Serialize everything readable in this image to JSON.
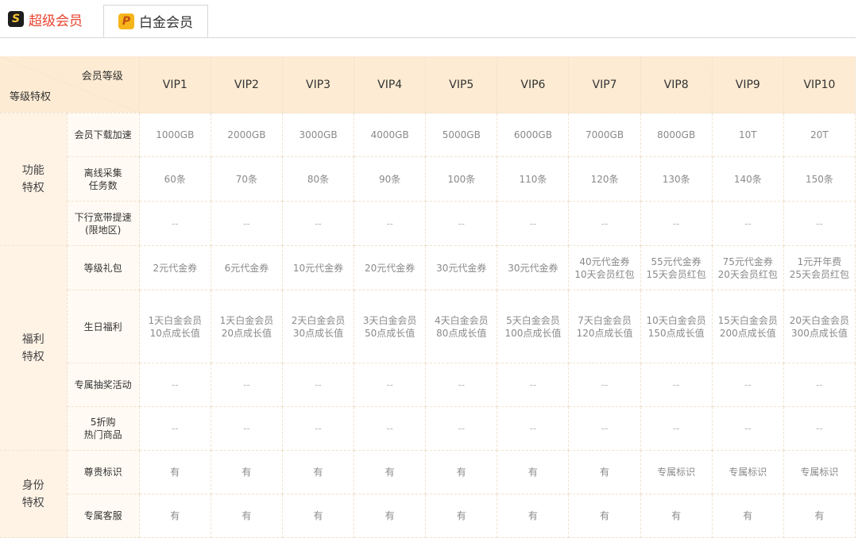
{
  "tabs": [
    {
      "icon": "S",
      "label": "超级会员"
    },
    {
      "icon": "P",
      "label": "白金会员"
    }
  ],
  "table": {
    "corner_top": "会员等级",
    "corner_bottom": "等级特权",
    "levels": [
      "VIP1",
      "VIP2",
      "VIP3",
      "VIP4",
      "VIP5",
      "VIP6",
      "VIP7",
      "VIP8",
      "VIP9",
      "VIP10"
    ],
    "groups": [
      {
        "name_line1": "功能",
        "name_line2": "特权",
        "rows": [
          {
            "feature": "会员下载加速",
            "values": [
              "1000GB",
              "2000GB",
              "3000GB",
              "4000GB",
              "5000GB",
              "6000GB",
              "7000GB",
              "8000GB",
              "10T",
              "20T"
            ]
          },
          {
            "feature": "离线采集\n任务数",
            "values": [
              "60条",
              "70条",
              "80条",
              "90条",
              "100条",
              "110条",
              "120条",
              "130条",
              "140条",
              "150条"
            ]
          },
          {
            "feature": "下行宽带提速\n(限地区)",
            "values": [
              "--",
              "--",
              "--",
              "--",
              "--",
              "--",
              "--",
              "--",
              "--",
              "--"
            ]
          }
        ]
      },
      {
        "name_line1": "福利",
        "name_line2": "特权",
        "rows": [
          {
            "feature": "等级礼包",
            "values": [
              "2元代金券",
              "6元代金券",
              "10元代金券",
              "20元代金券",
              "30元代金券",
              "30元代金券",
              "40元代金券\n10天会员红包",
              "55元代金券\n15天会员红包",
              "75元代金券\n20天会员红包",
              "1元开年费\n25天会员红包"
            ]
          },
          {
            "feature": "生日福利",
            "values": [
              "1天白金会员\n10点成长值",
              "1天白金会员\n20点成长值",
              "2天白金会员\n30点成长值",
              "3天白金会员\n50点成长值",
              "4天白金会员\n80点成长值",
              "5天白金会员\n100点成长值",
              "7天白金会员\n120点成长值",
              "10天白金会员\n150点成长值",
              "15天白金会员\n200点成长值",
              "20天白金会员\n300点成长值"
            ]
          },
          {
            "feature": "专属抽奖活动",
            "values": [
              "--",
              "--",
              "--",
              "--",
              "--",
              "--",
              "--",
              "--",
              "--",
              "--"
            ]
          },
          {
            "feature": "5折购\n热门商品",
            "values": [
              "--",
              "--",
              "--",
              "--",
              "--",
              "--",
              "--",
              "--",
              "--",
              "--"
            ]
          }
        ]
      },
      {
        "name_line1": "身份",
        "name_line2": "特权",
        "rows": [
          {
            "feature": "尊贵标识",
            "values": [
              "有",
              "有",
              "有",
              "有",
              "有",
              "有",
              "有",
              "专属标识",
              "专属标识",
              "专属标识"
            ]
          },
          {
            "feature": "专属客服",
            "values": [
              "有",
              "有",
              "有",
              "有",
              "有",
              "有",
              "有",
              "有",
              "有",
              "有"
            ]
          }
        ]
      }
    ]
  }
}
